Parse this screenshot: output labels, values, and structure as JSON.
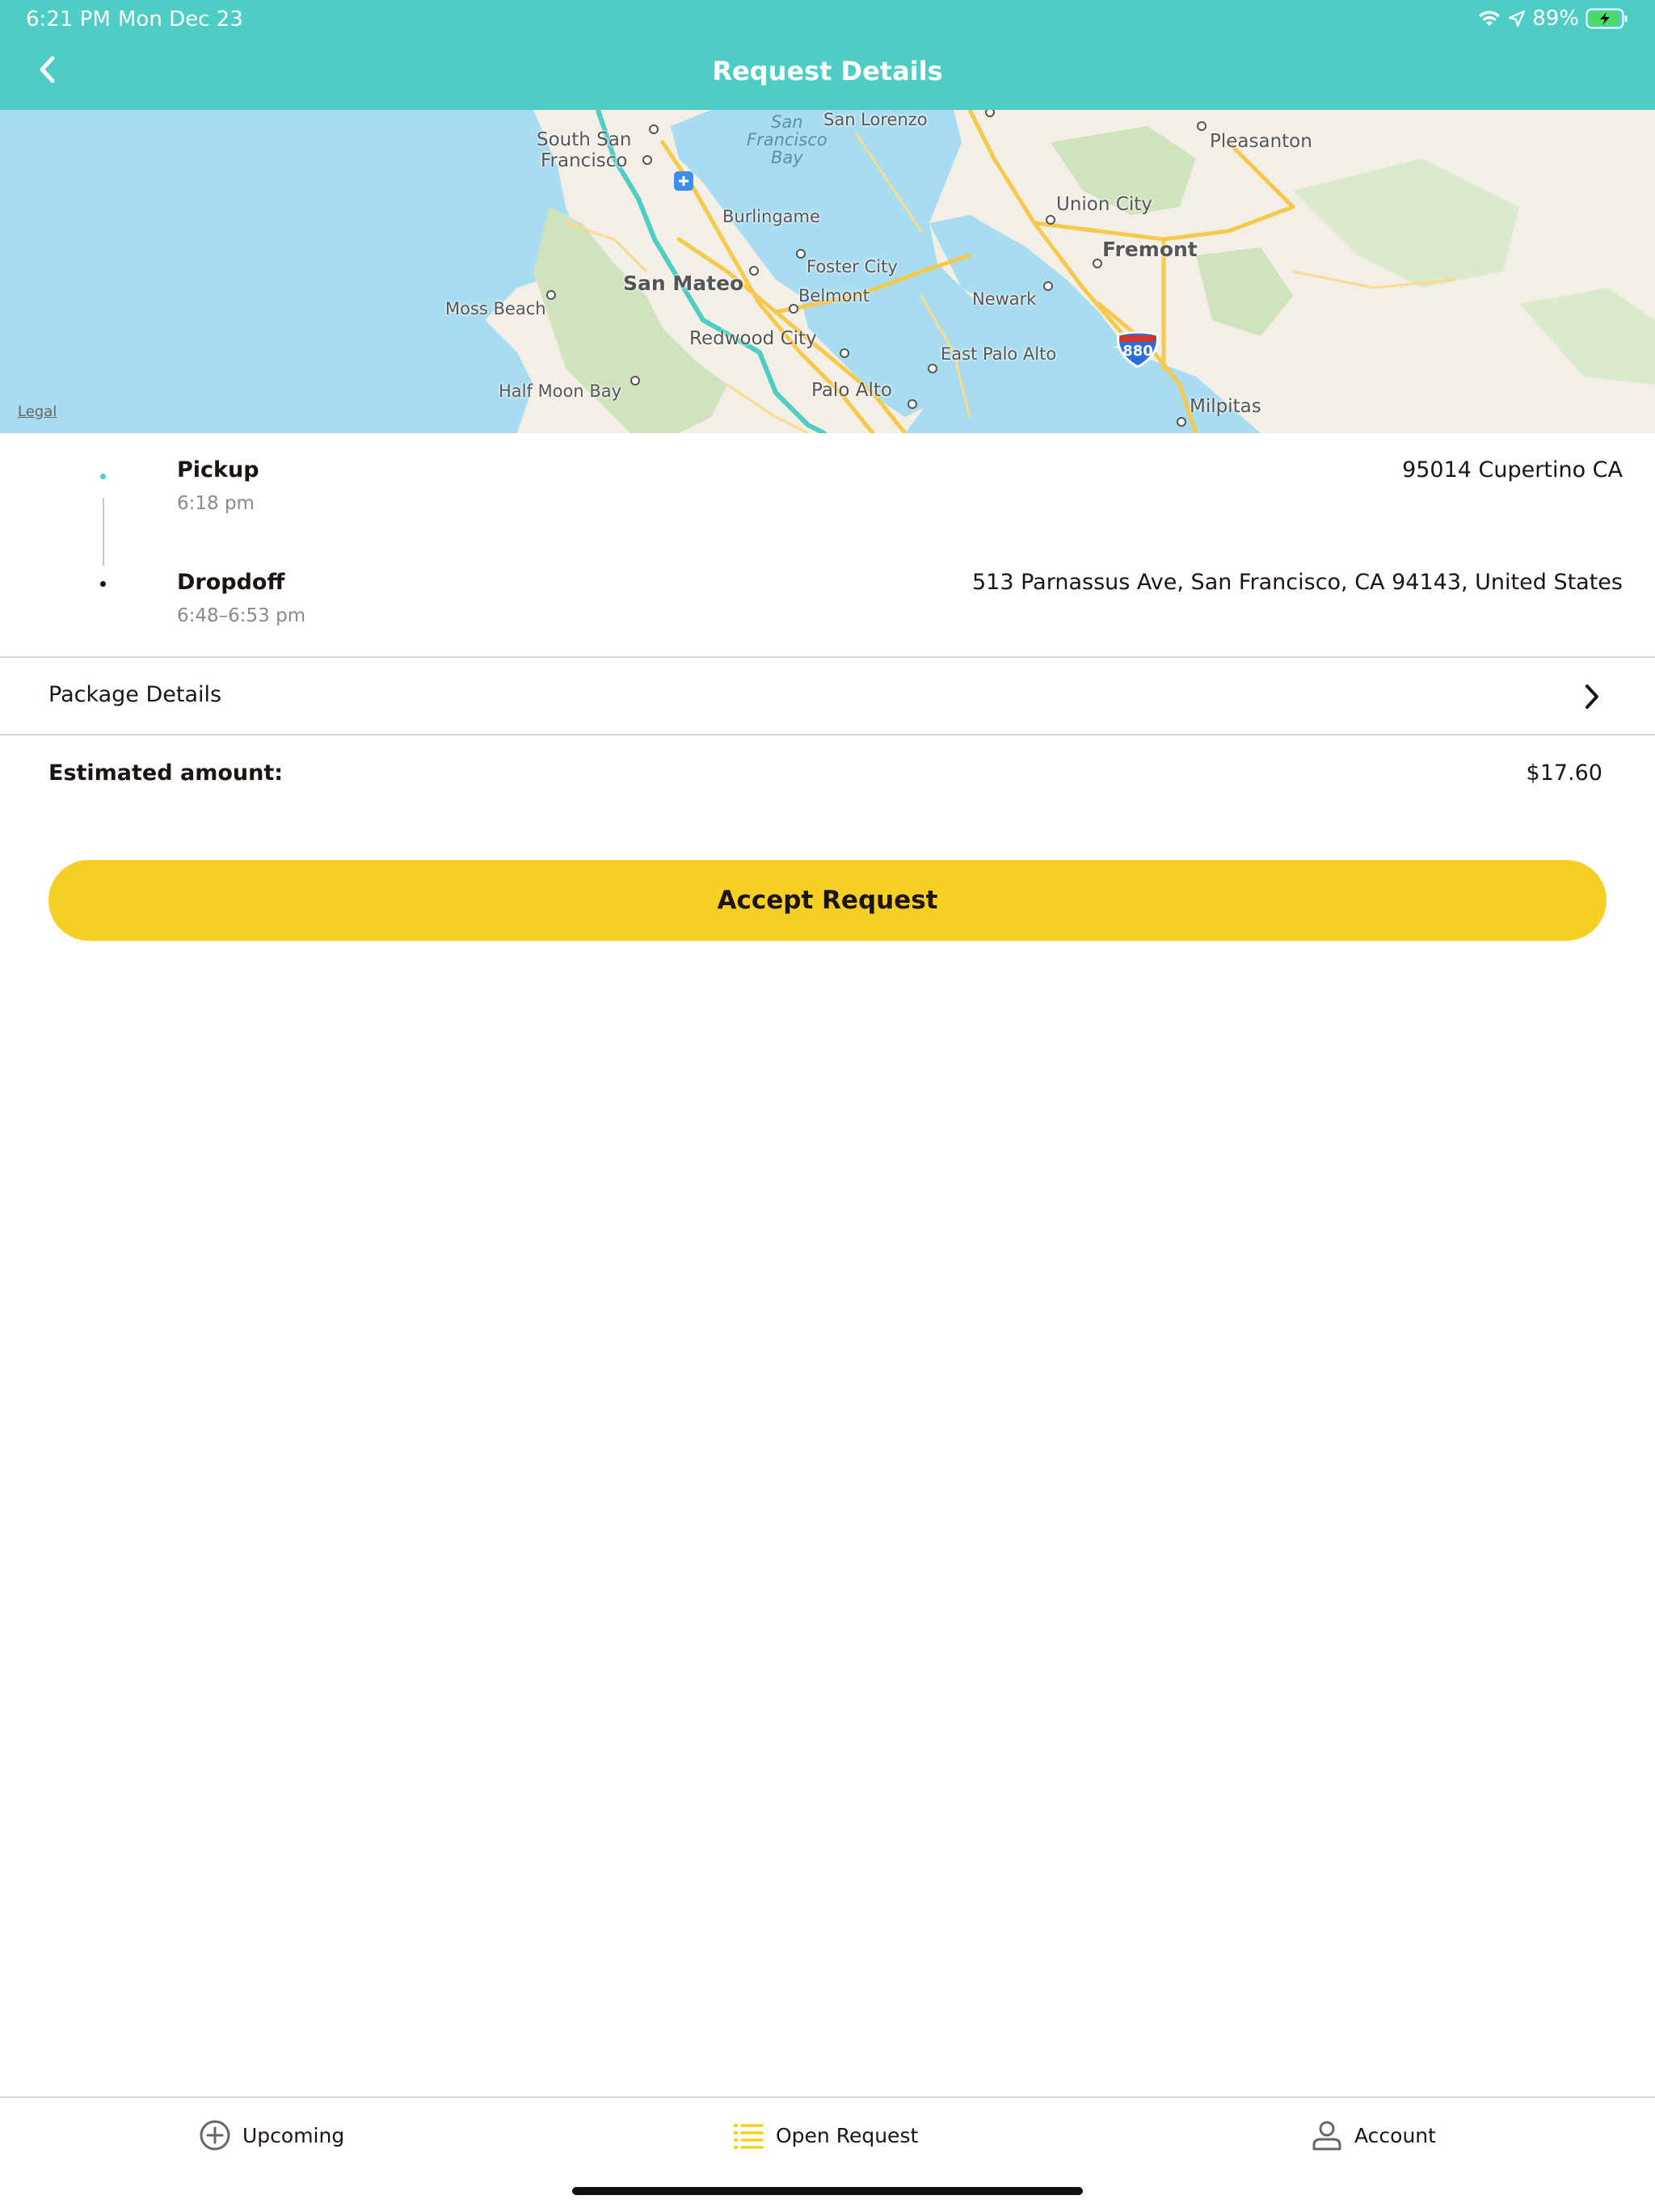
{
  "status_bar": {
    "time": "6:21 PM",
    "date": "Mon Dec 23",
    "battery_percent": "89%",
    "icons": [
      "wifi-icon",
      "location-arrow-icon",
      "battery-charging-icon"
    ]
  },
  "nav": {
    "title": "Request Details",
    "back_icon": "chevron-left-icon"
  },
  "map": {
    "legal": "Legal",
    "highway_shield": "880",
    "labels": {
      "south_san_francisco": "South San\nFrancisco",
      "san_francisco_bay": "San\nFrancisco\nBay",
      "san_lorenzo": "San Lorenzo",
      "pleasanton": "Pleasanton",
      "union_city": "Union City",
      "burlingame": "Burlingame",
      "fremont": "Fremont",
      "foster_city": "Foster City",
      "san_mateo": "San Mateo",
      "belmont": "Belmont",
      "newark": "Newark",
      "moss_beach": "Moss Beach",
      "redwood_city": "Redwood City",
      "east_palo_alto": "East Palo Alto",
      "half_moon_bay": "Half Moon Bay",
      "palo_alto": "Palo Alto",
      "milpitas": "Milpitas"
    }
  },
  "route": {
    "pickup": {
      "title": "Pickup",
      "time": "6:18 pm",
      "address": "95014  Cupertino CA"
    },
    "dropoff": {
      "title": "Dropdoff",
      "time": "6:48–6:53 pm",
      "address": "513 Parnassus Ave, San Francisco, CA 94143, United States"
    }
  },
  "package": {
    "label": "Package Details"
  },
  "estimate": {
    "label": "Estimated amount:",
    "value": "$17.60"
  },
  "accept_button": {
    "label": "Accept Request"
  },
  "tabbar": {
    "tabs": [
      {
        "label": "Upcoming",
        "icon": "plus-circle-icon"
      },
      {
        "label": "Open Request",
        "icon": "list-icon"
      },
      {
        "label": "Account",
        "icon": "person-icon"
      }
    ]
  },
  "colors": {
    "header": "#4ecdc4",
    "accent_yellow": "#f5cf24",
    "route_line": "#4ecdc4",
    "water": "#a8dcf0"
  }
}
